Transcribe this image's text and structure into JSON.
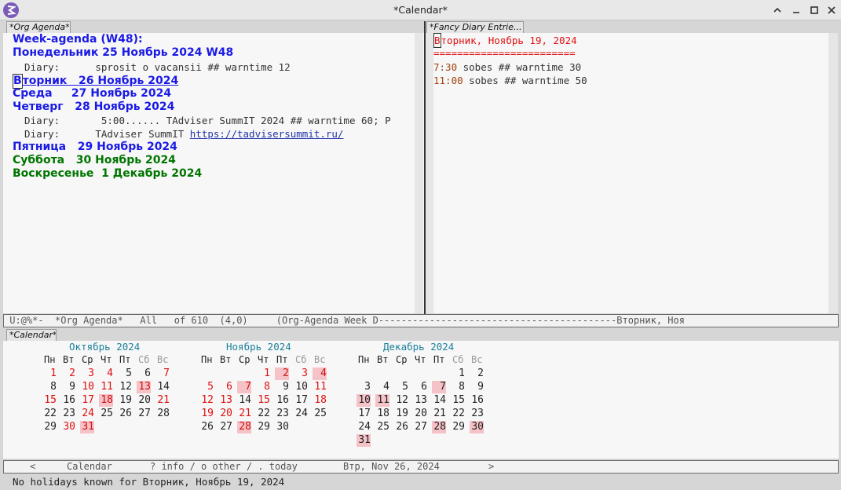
{
  "window": {
    "title": "*Calendar*"
  },
  "tabs": {
    "agenda": "*Org Agenda*",
    "diary": "*Fancy Diary Entrie...",
    "calendar": "*Calendar*"
  },
  "agenda": {
    "heading": "Week-agenda (W48):",
    "mon": "Понедельник 25 Ноябрь 2024 W48",
    "mon_diary": "  Diary:      sprosit o vacansii ## warntime 12",
    "tue_cursor": "В",
    "tue_rest": "торник   26 Ноябрь 2024",
    "wed": "Среда     27 Ноябрь 2024",
    "thu": "Четверг   28 Ноябрь 2024",
    "thu_diary1": "  Diary:       5:00...... TAdviser SummIT 2024 ## warntime 60; P",
    "thu_diary2_prefix": "  Diary:      TAdviser SummIT ",
    "thu_link": "https://tadvisersummit.ru/",
    "fri": "Пятница   29 Ноябрь 2024",
    "sat": "Суббота   30 Ноябрь 2024",
    "sun": "Воскресенье  1 Декабрь 2024"
  },
  "diary": {
    "date_cursor": "В",
    "date_rest": "торник, Ноябрь 19, 2024",
    "separator": "========================",
    "entries": [
      {
        "time": "7:30",
        "text": " sobes ## warntime 30"
      },
      {
        "time": "11:00",
        "text": " sobes ## warntime 50"
      }
    ]
  },
  "modeline_top": " U:@%*-  *Org Agenda*   All   of 610  (4,0)     (Org-Agenda Week D------------------------------------------Вторник, Ноя",
  "calendar": {
    "weekdays": [
      "Пн",
      "Вт",
      "Ср",
      "Чт",
      "Пт",
      "Сб",
      "Вс"
    ],
    "months": [
      {
        "name": "Октябрь 2024",
        "start": 1,
        "days": 31,
        "red": [
          1,
          2,
          3,
          4,
          7,
          10,
          11,
          15,
          17,
          21,
          24,
          30
        ],
        "hl": [
          13,
          18,
          31
        ]
      },
      {
        "name": "Ноябрь 2024",
        "start": 4,
        "days": 30,
        "red": [
          1,
          3,
          5,
          6,
          8,
          11,
          12,
          13,
          15,
          18,
          19,
          20,
          21
        ],
        "hl": [
          2,
          4,
          7,
          28
        ]
      },
      {
        "name": "Декабрь 2024",
        "start": 6,
        "days": 31,
        "red": [],
        "hl": [
          7,
          10,
          11,
          28,
          30,
          31
        ]
      }
    ]
  },
  "cal_modeline": {
    "prev": "<",
    "label": "Calendar",
    "help": "? info / o other / . today",
    "date": "Втр, Nov 26, 2024",
    "next": ">"
  },
  "echo": "No holidays known for Вторник, Ноябрь 19, 2024"
}
